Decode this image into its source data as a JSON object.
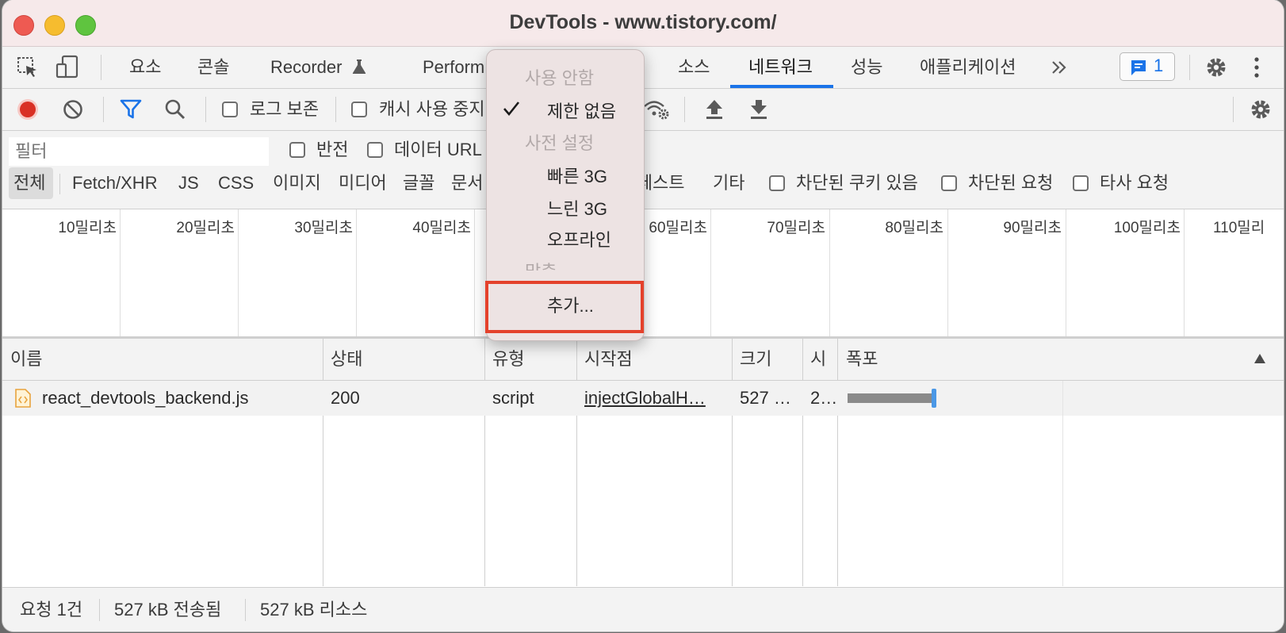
{
  "window": {
    "title": "DevTools - www.tistory.com/",
    "traffic_lights": [
      "#ee5a52",
      "#f6bc2f",
      "#5fc43f"
    ]
  },
  "tabs": {
    "items": [
      {
        "label": "요소"
      },
      {
        "label": "콘솔"
      },
      {
        "label": "Recorder"
      },
      {
        "label": "Perform"
      },
      {
        "label": "소스"
      },
      {
        "label": "네트워크"
      },
      {
        "label": "성능"
      },
      {
        "label": "애플리케이션"
      }
    ],
    "active": "네트워크",
    "more_icon": "double-chevron-right-icon",
    "issues_count": "1"
  },
  "toolbar": {
    "preserve_log": "로그 보존",
    "disable_cache": "캐시 사용 중지"
  },
  "filter": {
    "placeholder": "필터",
    "invert": "반전",
    "hide_data_urls": "데이터 URL",
    "types": [
      "전체",
      "Fetch/XHR",
      "JS",
      "CSS",
      "이미지",
      "미디어",
      "글꼴",
      "문서",
      "매니페스트",
      "기타"
    ],
    "visible_types": [
      "전체",
      "Fetch/XHR",
      "JS",
      "CSS",
      "이미지",
      "미디어",
      "글꼴",
      "문서",
      "|페스트",
      "기타"
    ],
    "blocked_cookies": "차단된 쿠키 있음",
    "blocked_requests": "차단된 요청",
    "third_party": "타사 요청"
  },
  "timeline": {
    "ticks": [
      "10밀리초",
      "20밀리초",
      "30밀리초",
      "40밀리초",
      "",
      "60밀리초",
      "70밀리초",
      "80밀리초",
      "90밀리초",
      "100밀리초",
      "110밀리"
    ]
  },
  "table": {
    "columns": [
      "이름",
      "상태",
      "유형",
      "시작점",
      "크기",
      "시",
      "폭포"
    ],
    "sort_icon": "triangle-up-icon",
    "rows": [
      {
        "name": "react_devtools_backend.js",
        "status": "200",
        "type": "script",
        "initiator": "injectGlobalH…",
        "size": "527 …",
        "time": "2…"
      }
    ]
  },
  "status": {
    "requests": "요청 1건",
    "transferred": "527 kB 전송됨",
    "resources": "527 kB 리소스"
  },
  "throttle_menu": {
    "disabled_header": "사용 안함",
    "no_throttling": "제한 없음",
    "presets_header": "사전 설정",
    "fast_3g": "빠른 3G",
    "slow_3g": "느린 3G",
    "offline": "오프라인",
    "custom_header": "맞춤",
    "add": "추가...",
    "checked_item": "no_throttling",
    "highlight_color": "#e4412b"
  },
  "colors": {
    "accent": "#1a73e8",
    "record": "#d93025",
    "waterfall_bar": "#8a8a8a",
    "waterfall_marker": "#4b98e6"
  }
}
